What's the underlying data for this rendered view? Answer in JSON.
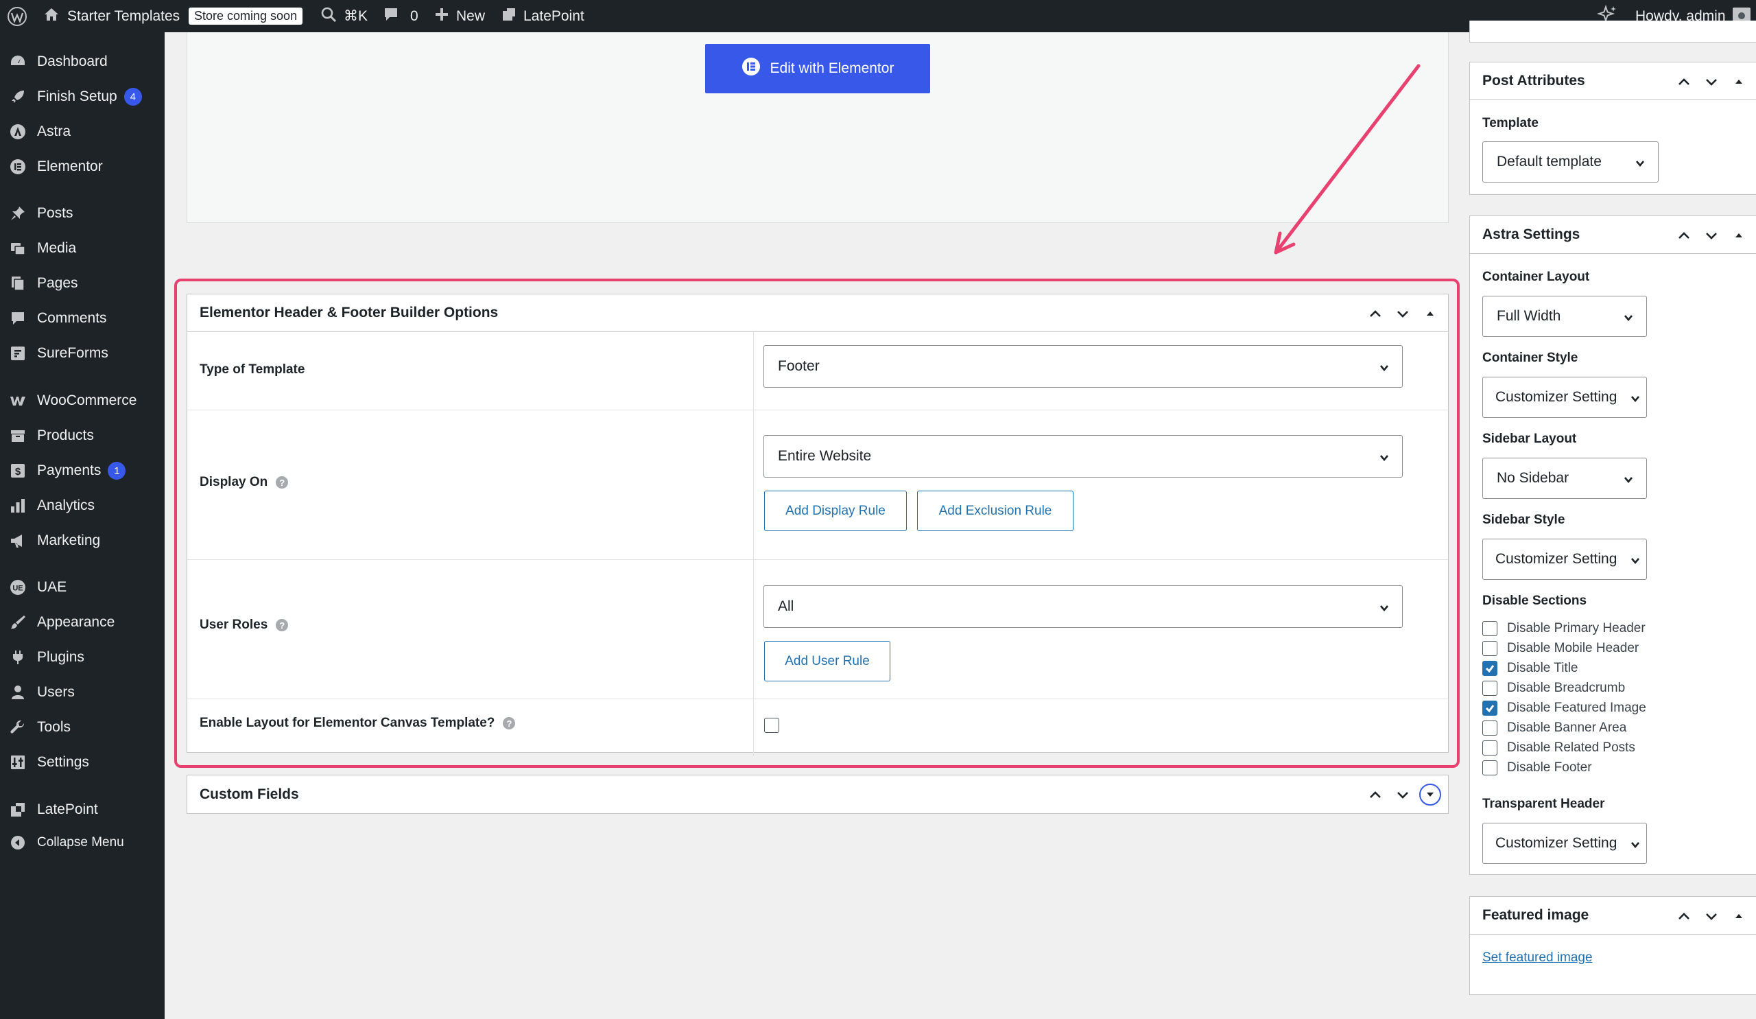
{
  "admin_bar": {
    "site_name": "Starter Templates",
    "store_badge": "Store coming soon",
    "search_shortcut": "⌘K",
    "comments_count": "0",
    "new_label": "New",
    "latepoint_label": "LatePoint",
    "greeting": "Howdy, admin"
  },
  "menu": {
    "dashboard": "Dashboard",
    "finish_setup": "Finish Setup",
    "finish_setup_badge": "4",
    "astra": "Astra",
    "elementor": "Elementor",
    "posts": "Posts",
    "media": "Media",
    "pages": "Pages",
    "comments": "Comments",
    "sureforms": "SureForms",
    "woocommerce": "WooCommerce",
    "products": "Products",
    "payments": "Payments",
    "payments_badge": "1",
    "analytics": "Analytics",
    "marketing": "Marketing",
    "uae": "UAE",
    "appearance": "Appearance",
    "plugins": "Plugins",
    "users": "Users",
    "tools": "Tools",
    "settings": "Settings",
    "latepoint": "LatePoint",
    "collapse": "Collapse Menu"
  },
  "editor": {
    "edit_button": "Edit with Elementor"
  },
  "ehf": {
    "title": "Elementor Header & Footer Builder Options",
    "type_label": "Type of Template",
    "type_value": "Footer",
    "display_label": "Display On",
    "display_value": "Entire Website",
    "add_display_rule": "Add Display Rule",
    "add_exclusion_rule": "Add Exclusion Rule",
    "roles_label": "User Roles",
    "roles_value": "All",
    "add_user_rule": "Add User Rule",
    "canvas_label": "Enable Layout for Elementor Canvas Template?",
    "canvas_checked": false
  },
  "custom_fields": {
    "title": "Custom Fields"
  },
  "post_attributes": {
    "title": "Post Attributes",
    "template_label": "Template",
    "template_value": "Default template"
  },
  "astra": {
    "title": "Astra Settings",
    "container_layout_label": "Container Layout",
    "container_layout_value": "Full Width",
    "container_style_label": "Container Style",
    "container_style_value": "Customizer Setting",
    "sidebar_layout_label": "Sidebar Layout",
    "sidebar_layout_value": "No Sidebar",
    "sidebar_style_label": "Sidebar Style",
    "sidebar_style_value": "Customizer Setting",
    "disable_sections_label": "Disable Sections",
    "disable_sections": [
      {
        "label": "Disable Primary Header",
        "checked": false
      },
      {
        "label": "Disable Mobile Header",
        "checked": false
      },
      {
        "label": "Disable Title",
        "checked": true
      },
      {
        "label": "Disable Breadcrumb",
        "checked": false
      },
      {
        "label": "Disable Featured Image",
        "checked": true
      },
      {
        "label": "Disable Banner Area",
        "checked": false
      },
      {
        "label": "Disable Related Posts",
        "checked": false
      },
      {
        "label": "Disable Footer",
        "checked": false
      }
    ],
    "transparent_header_label": "Transparent Header",
    "transparent_header_value": "Customizer Setting"
  },
  "featured_image": {
    "title": "Featured image",
    "link": "Set featured image"
  },
  "colors": {
    "admin_bg": "#1d2327",
    "accent": "#3858e9",
    "link": "#2271b1",
    "highlight": "#e8416f"
  }
}
